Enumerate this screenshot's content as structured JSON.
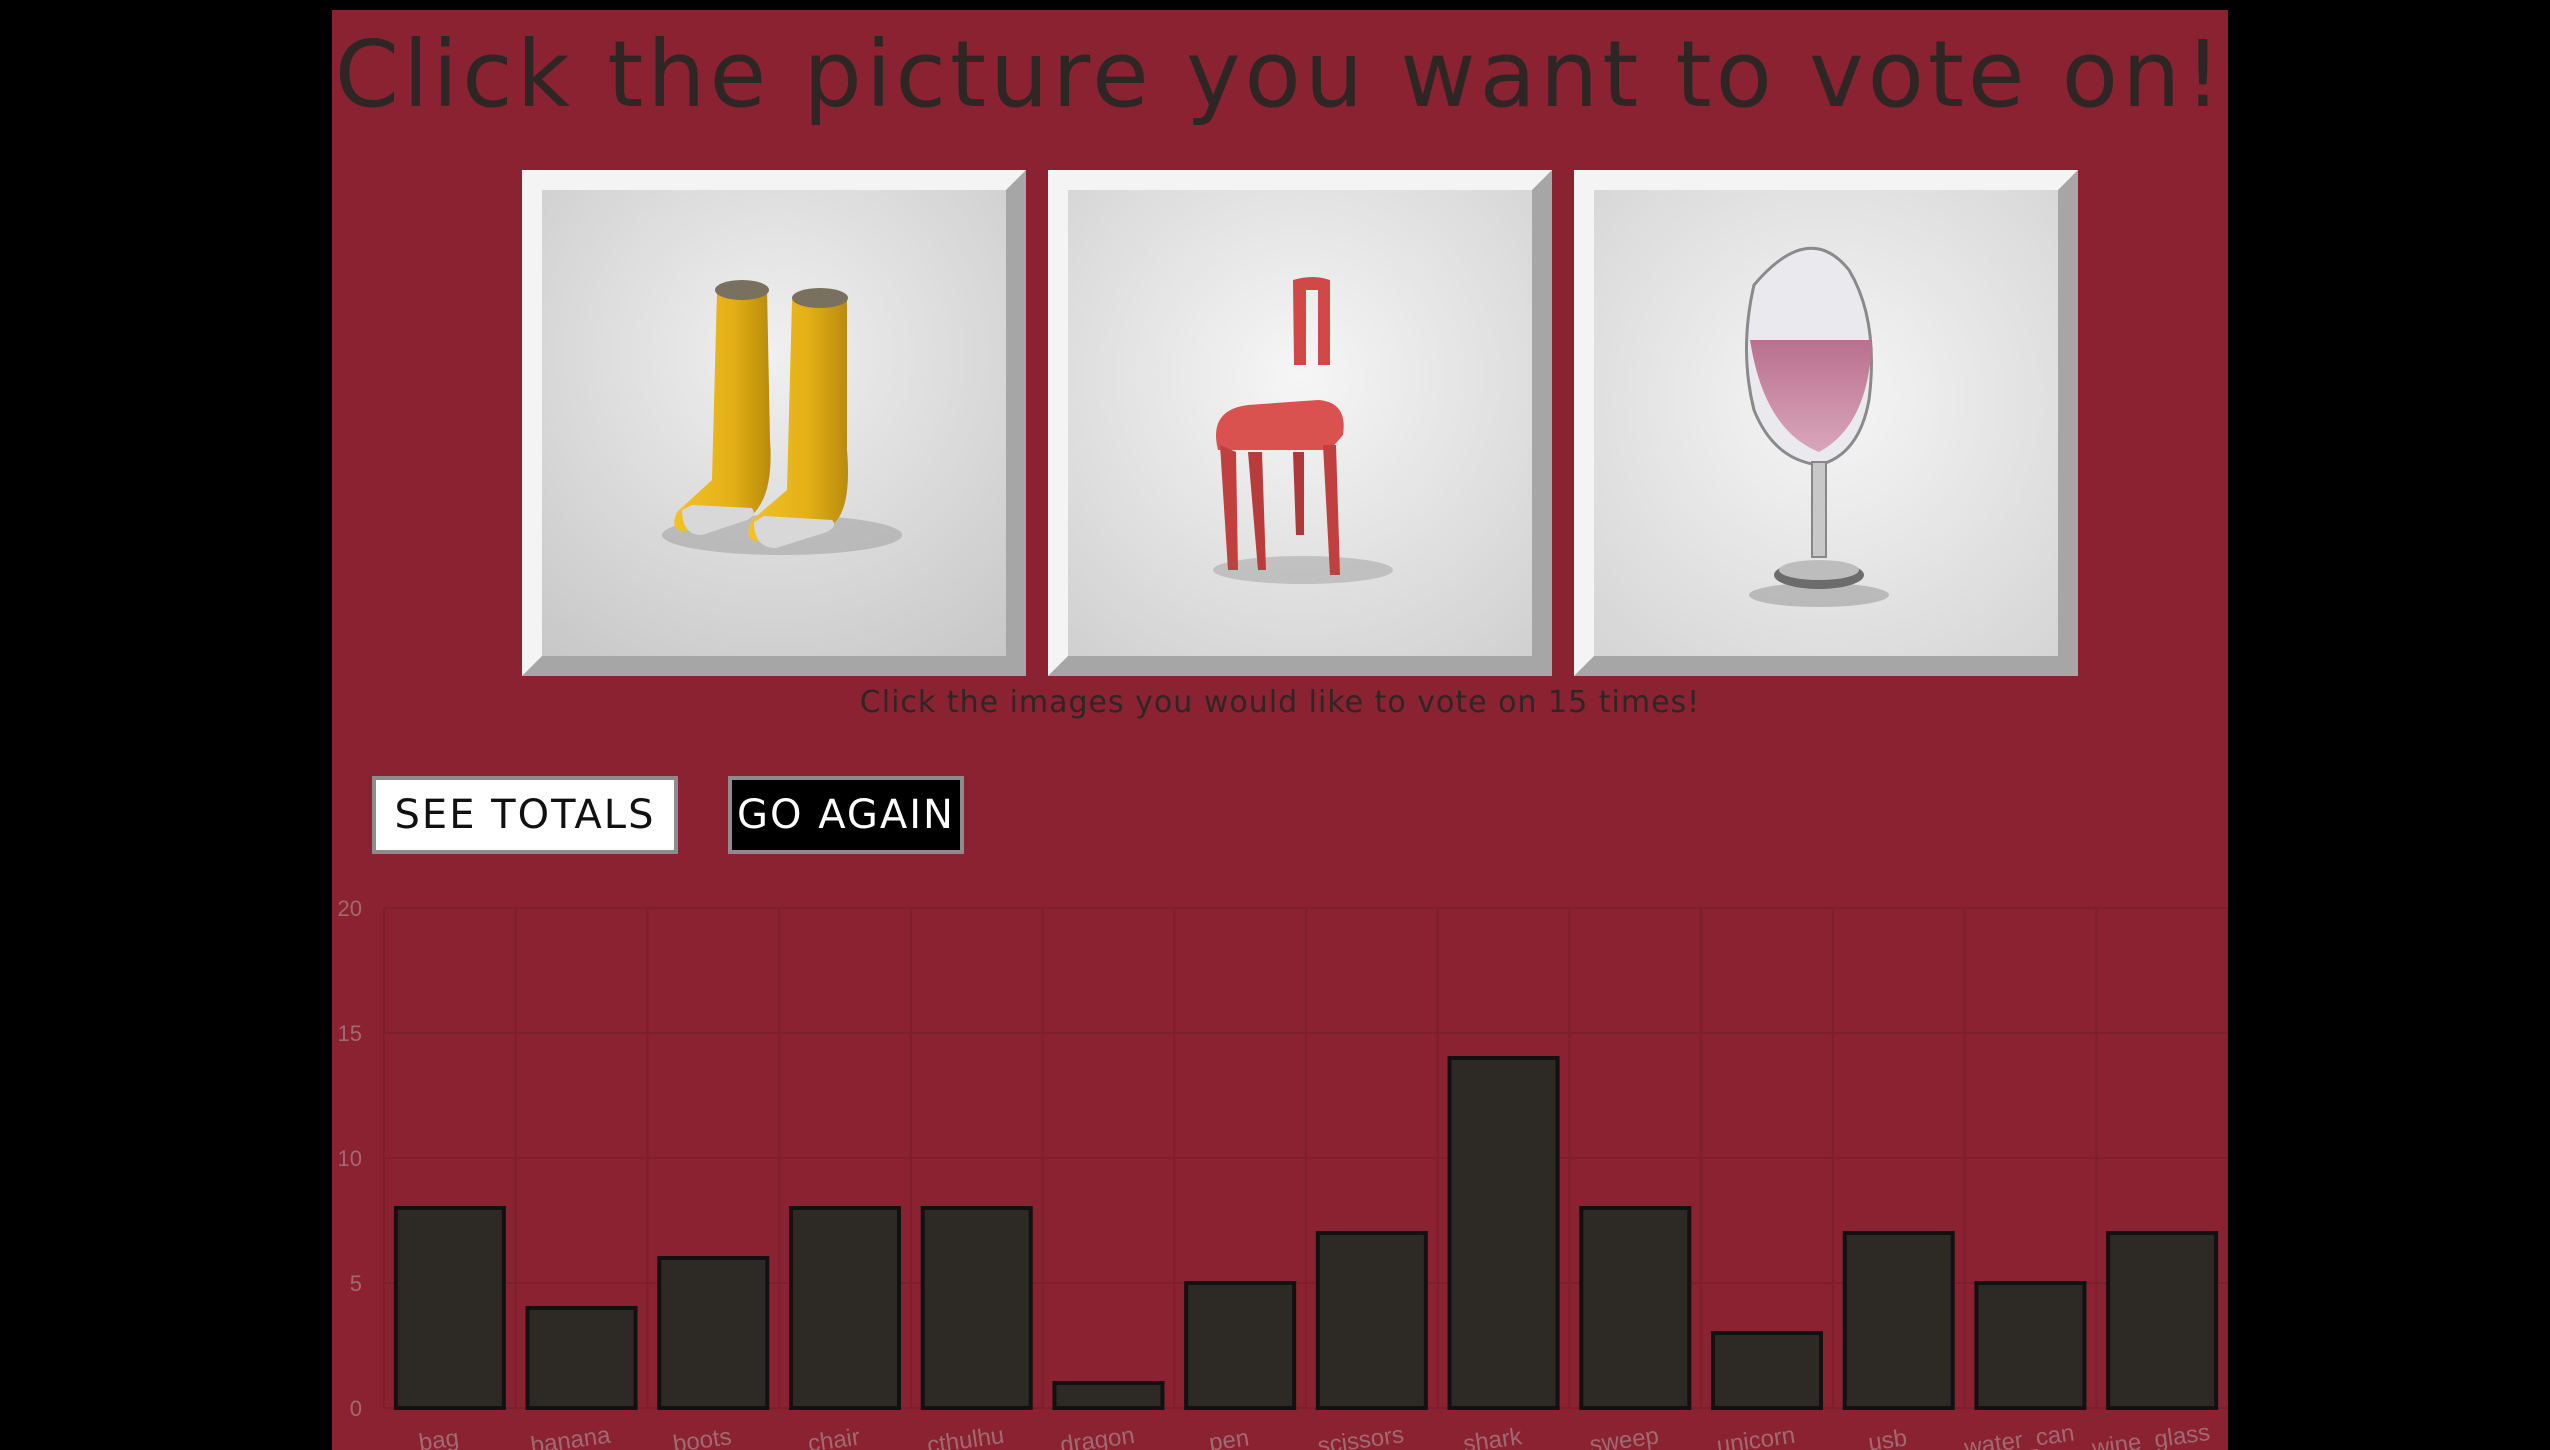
{
  "title": "Click the picture you want to vote on!",
  "images": [
    {
      "name": "boots",
      "label": "Yellow rain boots"
    },
    {
      "name": "chair",
      "label": "Red chair"
    },
    {
      "name": "wine_glass",
      "label": "Wine glass"
    }
  ],
  "instructions": "Click the images you would like to vote on 15 times!",
  "buttons": {
    "see_totals": "SEE TOTALS",
    "go_again": "GO AGAIN"
  },
  "colors": {
    "page_background": "#000000",
    "panel_background": "#8b2232",
    "bar_fill": "#2d2a26",
    "bar_border": "#111111",
    "axis_text": "#a06a70"
  },
  "chart_data": {
    "type": "bar",
    "categories": [
      "bag",
      "banana",
      "boots",
      "chair",
      "cthulhu",
      "dragon",
      "pen",
      "scissors",
      "shark",
      "sweep",
      "unicorn",
      "usb",
      "water_can",
      "wine_glass"
    ],
    "values": [
      8,
      4,
      6,
      8,
      8,
      1,
      5,
      7,
      14,
      8,
      3,
      7,
      5,
      7
    ],
    "ylim": [
      0,
      20
    ],
    "yticks": [
      0,
      5,
      10,
      15,
      20
    ],
    "grid": true,
    "legend": "none"
  }
}
